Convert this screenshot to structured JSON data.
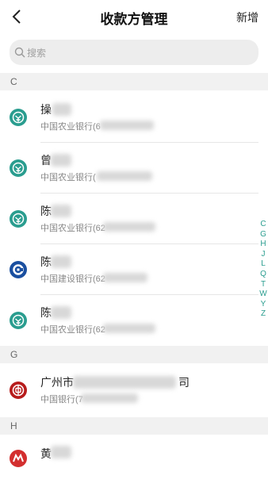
{
  "header": {
    "title": "收款方管理",
    "add_label": "新增"
  },
  "search": {
    "placeholder": "搜索"
  },
  "sections": [
    {
      "letter": "C",
      "rows": [
        {
          "name": "操",
          "bank": "中国农业银行(6"
        },
        {
          "name": "曾",
          "bank": "中国农业银行("
        },
        {
          "name": "陈",
          "bank": "中国农业银行(62"
        },
        {
          "name": "陈",
          "bank": "中国建设银行(62"
        },
        {
          "name": "陈",
          "bank": "中国农业银行(62"
        }
      ]
    },
    {
      "letter": "G",
      "rows": [
        {
          "name": "广州市",
          "name_tail": "司",
          "bank": "中国银行(7"
        }
      ]
    },
    {
      "letter": "H",
      "rows": [
        {
          "name": "黄"
        }
      ]
    }
  ],
  "index_letters": [
    "C",
    "G",
    "H",
    "J",
    "L",
    "Q",
    "T",
    "W",
    "Y",
    "Z"
  ],
  "colors": {
    "accent": "#2a9d8f",
    "abc_bank": "#2a9d8f",
    "ccb_bank": "#1a4fa0",
    "boc_bank": "#b71c1c",
    "cmb_bank": "#d32f2f"
  }
}
